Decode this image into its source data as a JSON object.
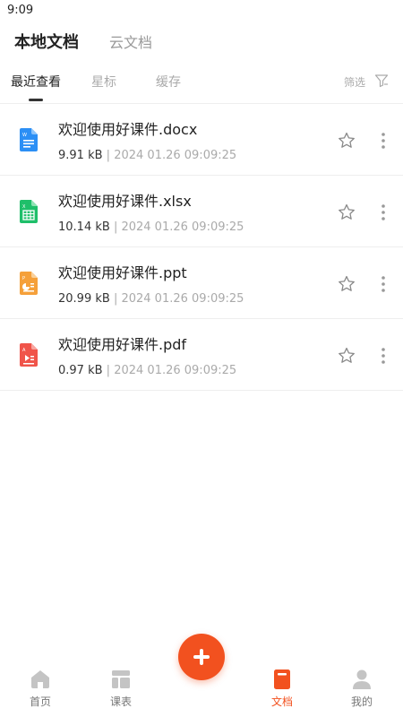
{
  "status_bar": {
    "time": "9:09"
  },
  "top_tabs": [
    {
      "label": "本地文档",
      "active": true
    },
    {
      "label": "云文档",
      "active": false
    }
  ],
  "sub_tabs": {
    "items": [
      {
        "label": "最近查看",
        "active": true
      },
      {
        "label": "星标",
        "active": false
      },
      {
        "label": "缓存",
        "active": false
      }
    ],
    "filter_label": "筛选"
  },
  "documents": [
    {
      "name": "欢迎使用好课件.docx",
      "size": "9.91 kB",
      "separator": "|",
      "date": "2024 01.26 09:09:25",
      "type": "word",
      "icon": "word-file-icon",
      "color": "#2b8ff5"
    },
    {
      "name": "欢迎使用好课件.xlsx",
      "size": "10.14 kB",
      "separator": "|",
      "date": "2024 01.26 09:09:25",
      "type": "excel",
      "icon": "excel-file-icon",
      "color": "#1fbf6a"
    },
    {
      "name": "欢迎使用好课件.ppt",
      "size": "20.99 kB",
      "separator": "|",
      "date": "2024 01.26 09:09:25",
      "type": "ppt",
      "icon": "ppt-file-icon",
      "color": "#f5a03a"
    },
    {
      "name": "欢迎使用好课件.pdf",
      "size": "0.97 kB",
      "separator": "|",
      "date": "2024 01.26 09:09:25",
      "type": "pdf",
      "icon": "pdf-file-icon",
      "color": "#f0544a"
    }
  ],
  "fab": {
    "icon": "plus-icon",
    "color": "#f2511f"
  },
  "bottom_nav": [
    {
      "label": "首页",
      "icon": "home-icon",
      "active": false
    },
    {
      "label": "课表",
      "icon": "schedule-icon",
      "active": false
    },
    {
      "label": "文档",
      "icon": "document-icon",
      "active": true
    },
    {
      "label": "我的",
      "icon": "profile-icon",
      "active": false
    }
  ],
  "colors": {
    "accent": "#f2511f",
    "inactive_icon": "#c4c4c4",
    "text_primary": "#222222",
    "text_secondary": "#aaaaaa"
  }
}
